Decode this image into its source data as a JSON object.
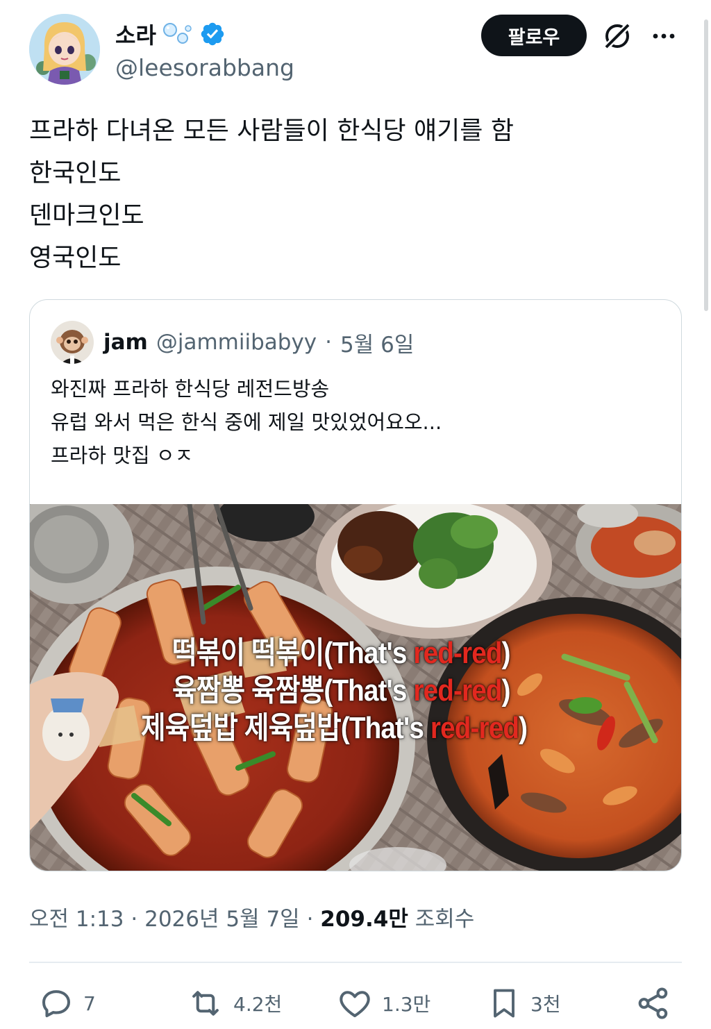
{
  "author": {
    "display_name": "소라",
    "handle": "@leesorabbang"
  },
  "follow_label": "팔로우",
  "tweet_lines": [
    "프라하 다녀온 모든 사람들이 한식당 얘기를 함",
    "한국인도",
    "덴마크인도",
    "영국인도"
  ],
  "quote": {
    "display_name": "jam",
    "handle": "@jammiibabyy",
    "date": "5월 6일",
    "lines": [
      "와진짜 프라하 한식당 레전드방송",
      "유럽 와서 먹은 한식 중에 제일 맛있었어요오...",
      "프라하 맛집 ㅇㅈ"
    ],
    "image_captions": [
      {
        "korean": "떡볶이 떡볶이",
        "prefix": "(That's ",
        "red": "red-red",
        "suffix": ")"
      },
      {
        "korean": "육짬뽕 육짬뽕",
        "prefix": "(That's ",
        "red": "red-red",
        "suffix": ")"
      },
      {
        "korean": "제육덮밥 제육덮밥",
        "prefix": "(That's ",
        "red": "red-red",
        "suffix": ")"
      }
    ]
  },
  "meta": {
    "time": "오전 1:13",
    "date": "2026년 5월 7일",
    "views": "209.4만",
    "views_label": "조회수"
  },
  "actions": {
    "replies": "7",
    "reposts": "4.2천",
    "likes": "1.3만",
    "bookmarks": "3천"
  },
  "colors": {
    "text": "#0f1419",
    "secondary": "#536471",
    "verified": "#1d9bf0",
    "border": "#cfd9de",
    "caption_red": "#e2281f"
  }
}
